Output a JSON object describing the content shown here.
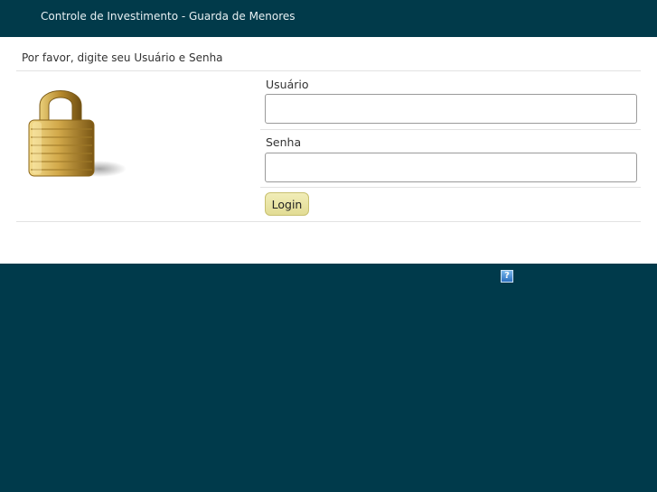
{
  "header": {
    "title": "Controle de Investimento - Guarda de Menores"
  },
  "login": {
    "prompt": "Por favor, digite seu Usuário e Senha",
    "username_label": "Usuário",
    "username_value": "",
    "password_label": "Senha",
    "password_value": "",
    "login_button": "Login",
    "lock_icon": "padlock-icon"
  },
  "footer": {
    "help_icon": "help-icon",
    "help_glyph": "?"
  },
  "colors": {
    "header_bg": "#013a4a",
    "footer_bg": "#003a4b",
    "button_bg": "#e9e4a5"
  }
}
